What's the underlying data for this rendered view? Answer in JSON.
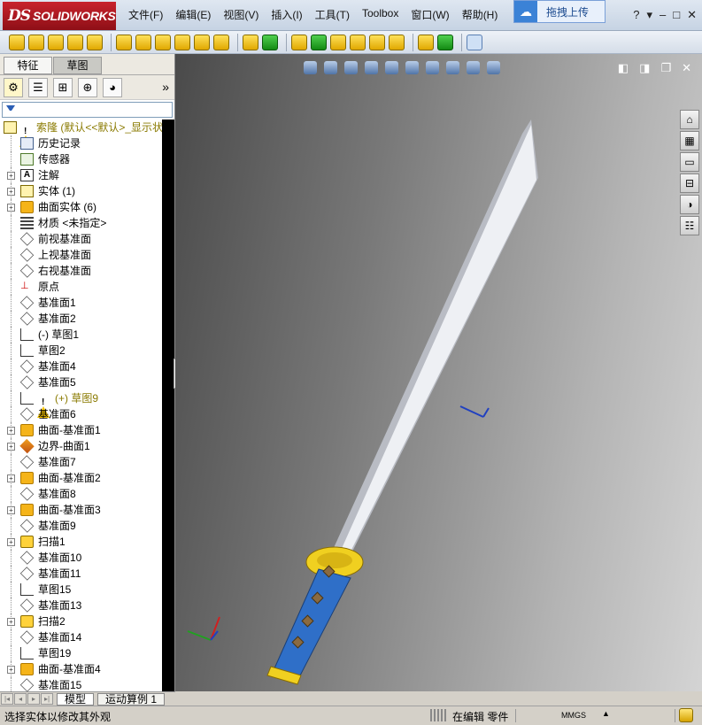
{
  "app": {
    "logo_prefix": "DS",
    "logo_name": "SOLIDWORKS"
  },
  "menu": [
    "文件(F)",
    "编辑(E)",
    "视图(V)",
    "插入(I)",
    "工具(T)",
    "Toolbox",
    "窗口(W)",
    "帮助(H)"
  ],
  "upload": {
    "label": "拖拽上传"
  },
  "window_controls": [
    "?",
    "▾",
    "–",
    "□",
    "✕"
  ],
  "panel_tabs": [
    {
      "label": "特征",
      "active": false
    },
    {
      "label": "草图",
      "active": true
    }
  ],
  "panel_more": "»",
  "tree": {
    "root_label": "索隆  (默认<<默认>_显示状态",
    "items": [
      {
        "label": "历史记录",
        "icon": "history-icon",
        "expand": false
      },
      {
        "label": "传感器",
        "icon": "sensor-icon",
        "expand": false
      },
      {
        "label": "注解",
        "icon": "annotation-icon",
        "expand": true
      },
      {
        "label": "实体 (1)",
        "icon": "solid-body-icon",
        "expand": true
      },
      {
        "label": "曲面实体 (6)",
        "icon": "surface-body-icon",
        "expand": true
      },
      {
        "label": "材质 <未指定>",
        "icon": "material-icon",
        "expand": false
      },
      {
        "label": "前视基准面",
        "icon": "plane-icon",
        "expand": false
      },
      {
        "label": "上视基准面",
        "icon": "plane-icon",
        "expand": false
      },
      {
        "label": "右视基准面",
        "icon": "plane-icon",
        "expand": false
      },
      {
        "label": "原点",
        "icon": "origin-icon",
        "expand": false
      },
      {
        "label": "基准面1",
        "icon": "plane-icon",
        "expand": false
      },
      {
        "label": "基准面2",
        "icon": "plane-icon",
        "expand": false
      },
      {
        "label": "(-) 草图1",
        "icon": "sketch-icon",
        "expand": false
      },
      {
        "label": "草图2",
        "icon": "sketch-icon",
        "expand": false
      },
      {
        "label": "基准面4",
        "icon": "plane-icon",
        "expand": false
      },
      {
        "label": "基准面5",
        "icon": "plane-icon",
        "expand": false
      },
      {
        "label": "(+) 草图9",
        "icon": "sketch-icon",
        "expand": false,
        "warning": true
      },
      {
        "label": "基准面6",
        "icon": "plane-icon",
        "expand": false
      },
      {
        "label": "曲面-基准面1",
        "icon": "surface-plane-icon",
        "expand": true
      },
      {
        "label": "边界-曲面1",
        "icon": "boundary-surface-icon",
        "expand": true
      },
      {
        "label": "基准面7",
        "icon": "plane-icon",
        "expand": false
      },
      {
        "label": "曲面-基准面2",
        "icon": "surface-plane-icon",
        "expand": true
      },
      {
        "label": "基准面8",
        "icon": "plane-icon",
        "expand": false
      },
      {
        "label": "曲面-基准面3",
        "icon": "surface-plane-icon",
        "expand": true
      },
      {
        "label": "基准面9",
        "icon": "plane-icon",
        "expand": false
      },
      {
        "label": "扫描1",
        "icon": "sweep-icon",
        "expand": true
      },
      {
        "label": "基准面10",
        "icon": "plane-icon",
        "expand": false
      },
      {
        "label": "基准面11",
        "icon": "plane-icon",
        "expand": false
      },
      {
        "label": "草图15",
        "icon": "sketch-icon",
        "expand": false
      },
      {
        "label": "基准面13",
        "icon": "plane-icon",
        "expand": false
      },
      {
        "label": "扫描2",
        "icon": "sweep-icon",
        "expand": true
      },
      {
        "label": "基准面14",
        "icon": "plane-icon",
        "expand": false
      },
      {
        "label": "草图19",
        "icon": "sketch-icon",
        "expand": false
      },
      {
        "label": "曲面-基准面4",
        "icon": "surface-plane-icon",
        "expand": true
      },
      {
        "label": "基准面15",
        "icon": "plane-icon",
        "expand": false
      }
    ]
  },
  "bottom_tabs": [
    {
      "label": "模型",
      "active": true
    },
    {
      "label": "运动算例 1",
      "active": false
    }
  ],
  "status": {
    "message": "选择实体以修改其外观",
    "mode": "在编辑",
    "doc_type": "零件",
    "units": "MMGS",
    "units_arrow": "▲"
  },
  "colors": {
    "blade": "#b9bcc4",
    "blade_edge": "#eef0f4",
    "tsuba": "#f0d020",
    "handle": "#2f6fc8",
    "rivet": "#8a6a40"
  }
}
